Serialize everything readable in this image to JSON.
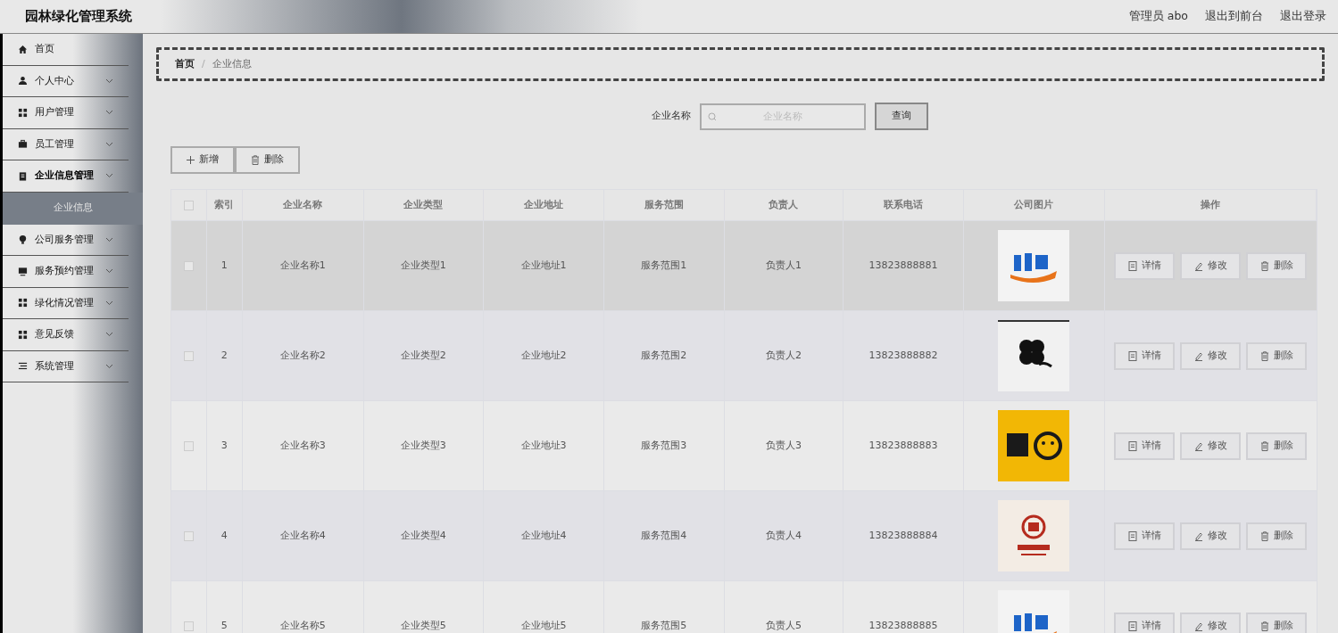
{
  "header": {
    "title": "园林绿化管理系统",
    "user": "管理员 abo",
    "links": [
      "退出到前台",
      "退出登录"
    ]
  },
  "sidebar": {
    "items": [
      {
        "label": "首页",
        "kind": "home",
        "has_caret": false,
        "expanded": false
      },
      {
        "label": "个人中心",
        "kind": "user",
        "has_caret": true,
        "expanded": false
      },
      {
        "label": "用户管理",
        "kind": "grid",
        "has_caret": true,
        "expanded": false
      },
      {
        "label": "员工管理",
        "kind": "briefcase",
        "has_caret": true,
        "expanded": false
      },
      {
        "label": "企业信息管理",
        "kind": "clipboard",
        "has_caret": true,
        "expanded": true,
        "children": [
          {
            "label": "企业信息",
            "selected": true
          }
        ]
      },
      {
        "label": "公司服务管理",
        "kind": "bulb",
        "has_caret": true,
        "expanded": false
      },
      {
        "label": "服务预约管理",
        "kind": "monitor",
        "has_caret": true,
        "expanded": false
      },
      {
        "label": "绿化情况管理",
        "kind": "grid",
        "has_caret": true,
        "expanded": false
      },
      {
        "label": "意见反馈",
        "kind": "grid",
        "has_caret": true,
        "expanded": false
      },
      {
        "label": "系统管理",
        "kind": "list",
        "has_caret": true,
        "expanded": false
      }
    ]
  },
  "breadcrumb": {
    "items": [
      "首页",
      "企业信息"
    ],
    "separator": "/"
  },
  "search": {
    "label": "企业名称",
    "placeholder": "企业名称",
    "button": "查询"
  },
  "actions": [
    "新增",
    "删除"
  ],
  "table": {
    "all_checked": false,
    "columns": [
      "索引",
      "企业名称",
      "企业类型",
      "企业地址",
      "服务范围",
      "负责人",
      "联系电话",
      "公司图片",
      "操作"
    ],
    "rows": [
      {
        "checked": false,
        "highlighted": true,
        "cells": [
          "1",
          "企业名称1",
          "企业类型1",
          "企业地址1",
          "服务范围1",
          "负责人1",
          "13823888881"
        ],
        "buttons": [
          "详情",
          "修改",
          "删除"
        ]
      },
      {
        "checked": false,
        "highlighted": false,
        "cells": [
          "2",
          "企业名称2",
          "企业类型2",
          "企业地址2",
          "服务范围2",
          "负责人2",
          "13823888882"
        ],
        "buttons": [
          "详情",
          "修改",
          "删除"
        ]
      },
      {
        "checked": false,
        "highlighted": false,
        "cells": [
          "3",
          "企业名称3",
          "企业类型3",
          "企业地址3",
          "服务范围3",
          "负责人3",
          "13823888883"
        ],
        "buttons": [
          "详情",
          "修改",
          "删除"
        ]
      },
      {
        "checked": false,
        "highlighted": false,
        "cells": [
          "4",
          "企业名称4",
          "企业类型4",
          "企业地址4",
          "服务范围4",
          "负责人4",
          "13823888884"
        ],
        "buttons": [
          "详情",
          "修改",
          "删除"
        ]
      },
      {
        "checked": false,
        "highlighted": false,
        "cells": [
          "5",
          "企业名称5",
          "企业类型5",
          "企业地址5",
          "服务范围5",
          "负责人5",
          "13823888885"
        ],
        "buttons": [
          "详情",
          "修改",
          "删除"
        ]
      }
    ]
  }
}
